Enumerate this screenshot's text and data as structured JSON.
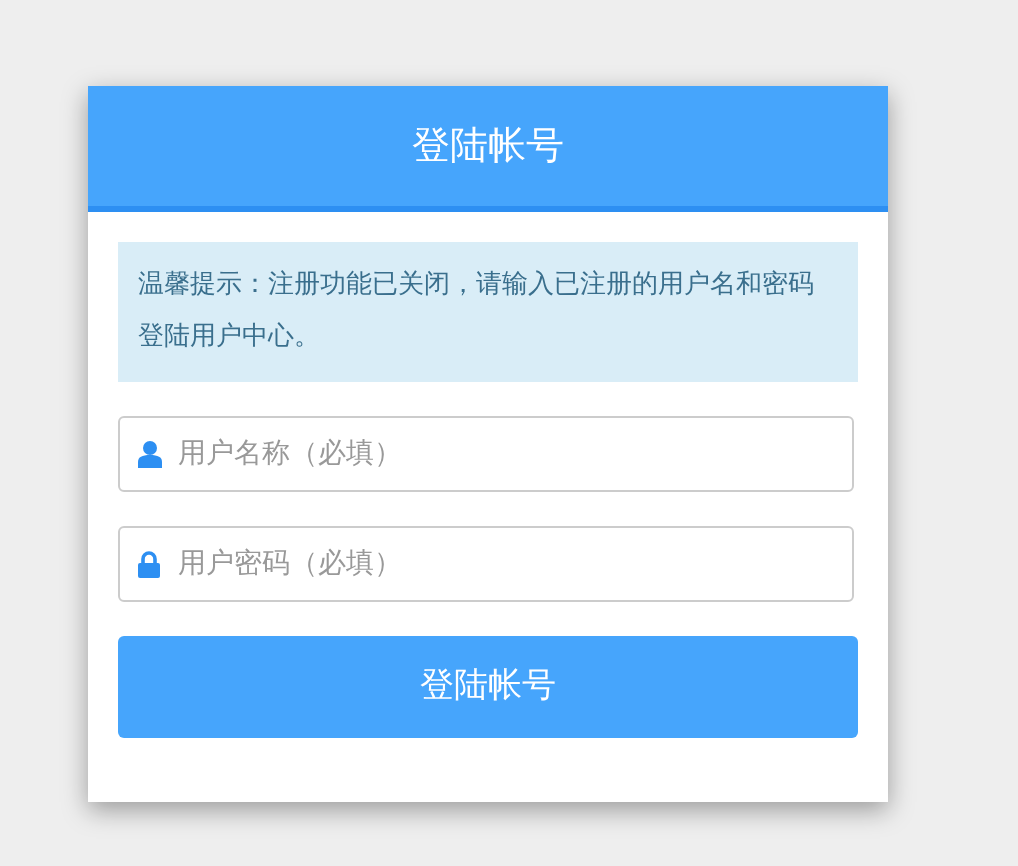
{
  "header": {
    "title": "登陆帐号"
  },
  "notice": "温馨提示：注册功能已关闭，请输入已注册的用户名和密码登陆用户中心。",
  "fields": [
    {
      "kind": "user",
      "placeholder": "用户名称（必填）"
    },
    {
      "kind": "password",
      "placeholder": "用户密码（必填）"
    }
  ],
  "submit": "登陆帐号"
}
